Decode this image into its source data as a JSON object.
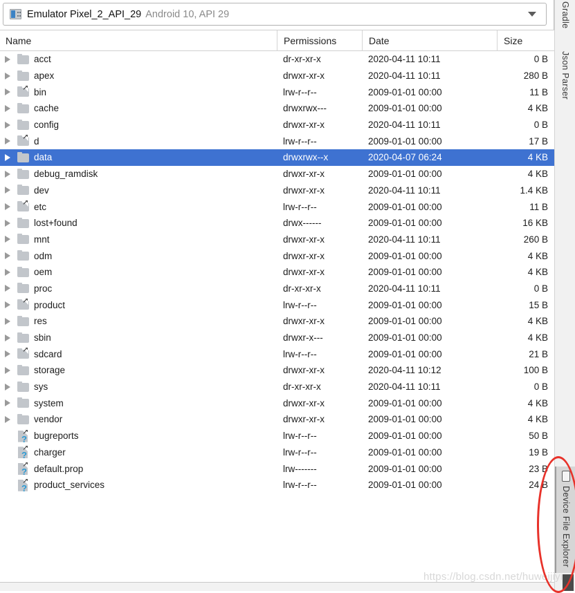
{
  "window": {
    "tool_window_title": "Device File Explorer"
  },
  "device_selector": {
    "icon": "android-emulator-device-icon",
    "device_name": "Emulator Pixel_2_API_29",
    "device_detail": "Android 10, API 29",
    "dropdown_icon": "chevron-down-icon"
  },
  "table": {
    "columns": [
      "Name",
      "Permissions",
      "Date",
      "Size"
    ],
    "selected_row_color": "#3e72d1",
    "rows": [
      {
        "name": "acct",
        "type": "folder",
        "expandable": true,
        "permissions": "dr-xr-xr-x",
        "date": "2020-04-11 10:11",
        "size": "0 B",
        "selected": false
      },
      {
        "name": "apex",
        "type": "folder",
        "expandable": true,
        "permissions": "drwxr-xr-x",
        "date": "2020-04-11 10:11",
        "size": "280 B",
        "selected": false
      },
      {
        "name": "bin",
        "type": "folder-link",
        "expandable": true,
        "permissions": "lrw-r--r--",
        "date": "2009-01-01 00:00",
        "size": "11 B",
        "selected": false
      },
      {
        "name": "cache",
        "type": "folder",
        "expandable": true,
        "permissions": "drwxrwx---",
        "date": "2009-01-01 00:00",
        "size": "4 KB",
        "selected": false
      },
      {
        "name": "config",
        "type": "folder",
        "expandable": true,
        "permissions": "drwxr-xr-x",
        "date": "2020-04-11 10:11",
        "size": "0 B",
        "selected": false
      },
      {
        "name": "d",
        "type": "folder-link",
        "expandable": true,
        "permissions": "lrw-r--r--",
        "date": "2009-01-01 00:00",
        "size": "17 B",
        "selected": false
      },
      {
        "name": "data",
        "type": "folder",
        "expandable": true,
        "permissions": "drwxrwx--x",
        "date": "2020-04-07 06:24",
        "size": "4 KB",
        "selected": true
      },
      {
        "name": "debug_ramdisk",
        "type": "folder",
        "expandable": true,
        "permissions": "drwxr-xr-x",
        "date": "2009-01-01 00:00",
        "size": "4 KB",
        "selected": false
      },
      {
        "name": "dev",
        "type": "folder",
        "expandable": true,
        "permissions": "drwxr-xr-x",
        "date": "2020-04-11 10:11",
        "size": "1.4 KB",
        "selected": false
      },
      {
        "name": "etc",
        "type": "folder-link",
        "expandable": true,
        "permissions": "lrw-r--r--",
        "date": "2009-01-01 00:00",
        "size": "11 B",
        "selected": false
      },
      {
        "name": "lost+found",
        "type": "folder",
        "expandable": true,
        "permissions": "drwx------",
        "date": "2009-01-01 00:00",
        "size": "16 KB",
        "selected": false
      },
      {
        "name": "mnt",
        "type": "folder",
        "expandable": true,
        "permissions": "drwxr-xr-x",
        "date": "2020-04-11 10:11",
        "size": "260 B",
        "selected": false
      },
      {
        "name": "odm",
        "type": "folder",
        "expandable": true,
        "permissions": "drwxr-xr-x",
        "date": "2009-01-01 00:00",
        "size": "4 KB",
        "selected": false
      },
      {
        "name": "oem",
        "type": "folder",
        "expandable": true,
        "permissions": "drwxr-xr-x",
        "date": "2009-01-01 00:00",
        "size": "4 KB",
        "selected": false
      },
      {
        "name": "proc",
        "type": "folder",
        "expandable": true,
        "permissions": "dr-xr-xr-x",
        "date": "2020-04-11 10:11",
        "size": "0 B",
        "selected": false
      },
      {
        "name": "product",
        "type": "folder-link",
        "expandable": true,
        "permissions": "lrw-r--r--",
        "date": "2009-01-01 00:00",
        "size": "15 B",
        "selected": false
      },
      {
        "name": "res",
        "type": "folder",
        "expandable": true,
        "permissions": "drwxr-xr-x",
        "date": "2009-01-01 00:00",
        "size": "4 KB",
        "selected": false
      },
      {
        "name": "sbin",
        "type": "folder",
        "expandable": true,
        "permissions": "drwxr-x---",
        "date": "2009-01-01 00:00",
        "size": "4 KB",
        "selected": false
      },
      {
        "name": "sdcard",
        "type": "folder-link",
        "expandable": true,
        "permissions": "lrw-r--r--",
        "date": "2009-01-01 00:00",
        "size": "21 B",
        "selected": false
      },
      {
        "name": "storage",
        "type": "folder",
        "expandable": true,
        "permissions": "drwxr-xr-x",
        "date": "2020-04-11 10:12",
        "size": "100 B",
        "selected": false
      },
      {
        "name": "sys",
        "type": "folder",
        "expandable": true,
        "permissions": "dr-xr-xr-x",
        "date": "2020-04-11 10:11",
        "size": "0 B",
        "selected": false
      },
      {
        "name": "system",
        "type": "folder",
        "expandable": true,
        "permissions": "drwxr-xr-x",
        "date": "2009-01-01 00:00",
        "size": "4 KB",
        "selected": false
      },
      {
        "name": "vendor",
        "type": "folder",
        "expandable": true,
        "permissions": "drwxr-xr-x",
        "date": "2009-01-01 00:00",
        "size": "4 KB",
        "selected": false
      },
      {
        "name": "bugreports",
        "type": "file-link",
        "expandable": false,
        "permissions": "lrw-r--r--",
        "date": "2009-01-01 00:00",
        "size": "50 B",
        "selected": false
      },
      {
        "name": "charger",
        "type": "file-link",
        "expandable": false,
        "permissions": "lrw-r--r--",
        "date": "2009-01-01 00:00",
        "size": "19 B",
        "selected": false
      },
      {
        "name": "default.prop",
        "type": "file-link",
        "expandable": false,
        "permissions": "lrw-------",
        "date": "2009-01-01 00:00",
        "size": "23 B",
        "selected": false
      },
      {
        "name": "product_services",
        "type": "file-link",
        "expandable": false,
        "permissions": "lrw-r--r--",
        "date": "2009-01-01 00:00",
        "size": "24 B",
        "selected": false
      }
    ]
  },
  "right_sidebar": {
    "tabs": [
      {
        "label": "Gradle",
        "active": false,
        "icon": null
      },
      {
        "label": "Json Parser",
        "active": false,
        "icon": null
      },
      {
        "label": "Device File Explorer",
        "active": true,
        "icon": "device-phone-icon"
      }
    ]
  },
  "annotation": {
    "ellipse_color": "#e8322a",
    "target": "Device File Explorer"
  },
  "watermark": {
    "text": "https://blog.csdn.net/huweijiyi"
  }
}
